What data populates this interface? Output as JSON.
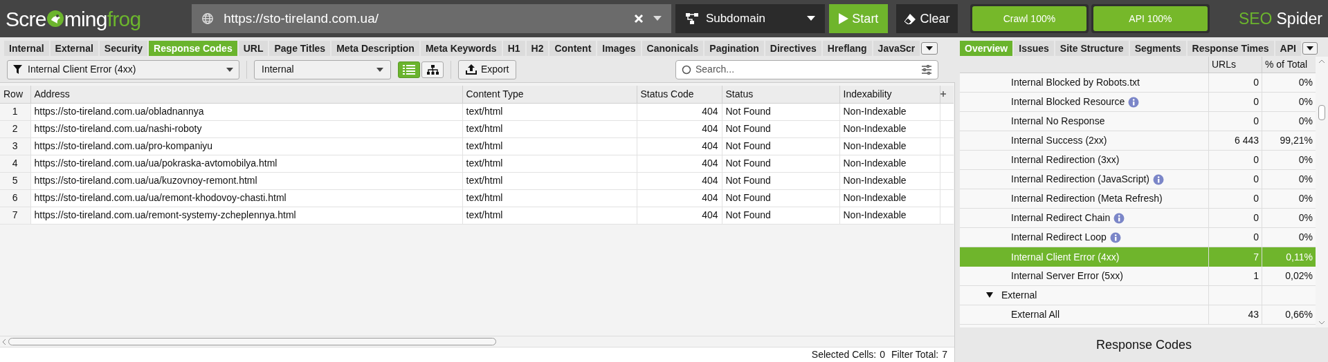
{
  "logo": {
    "parts": [
      {
        "text": "Scre",
        "color": "#ffffff"
      },
      {
        "text": "ming",
        "color": "#ffffff"
      },
      {
        "text": "frog",
        "color": "#6cb52d"
      }
    ]
  },
  "url_field": {
    "value": "https://sto-tireland.com.ua/"
  },
  "mode_dropdown": {
    "value": "Subdomain"
  },
  "start_button": "Start",
  "clear_button": "Clear",
  "progress": [
    {
      "label": "Crawl 100%",
      "level": 1
    },
    {
      "label": "API 100%",
      "level": 1
    }
  ],
  "brand": {
    "parts": [
      {
        "text": "SEO",
        "color": "#6cb52d"
      },
      {
        "text": "Spider",
        "color": "#ffffff"
      }
    ]
  },
  "left_tabs": [
    {
      "label": "Internal",
      "selected": false
    },
    {
      "label": "External",
      "selected": false
    },
    {
      "label": "Security",
      "selected": false
    },
    {
      "label": "Response Codes",
      "selected": true
    },
    {
      "label": "URL",
      "selected": false
    },
    {
      "label": "Page Titles",
      "selected": false
    },
    {
      "label": "Meta Description",
      "selected": false
    },
    {
      "label": "Meta Keywords",
      "selected": false
    },
    {
      "label": "H1",
      "selected": false
    },
    {
      "label": "H2",
      "selected": false
    },
    {
      "label": "Content",
      "selected": false
    },
    {
      "label": "Images",
      "selected": false
    },
    {
      "label": "Canonicals",
      "selected": false
    },
    {
      "label": "Pagination",
      "selected": false
    },
    {
      "label": "Directives",
      "selected": false
    },
    {
      "label": "Hreflang",
      "selected": false
    },
    {
      "label": "JavaScr",
      "selected": false
    }
  ],
  "toolbar": {
    "filter": "Internal Client Error (4xx)",
    "scope": "Internal",
    "views": [
      {
        "kind": "list",
        "selected": true
      },
      {
        "kind": "tree",
        "selected": false
      }
    ],
    "export": "Export",
    "search": {
      "placeholder": "Search..."
    }
  },
  "table": {
    "columns": [
      "Row",
      "Address",
      "Content Type",
      "Status Code",
      "Status",
      "Indexability"
    ],
    "rows": [
      [
        "1",
        "https://sto-tireland.com.ua/obladnannya",
        "text/html",
        "404",
        "Not Found",
        "Non-Indexable"
      ],
      [
        "2",
        "https://sto-tireland.com.ua/nashi-roboty",
        "text/html",
        "404",
        "Not Found",
        "Non-Indexable"
      ],
      [
        "3",
        "https://sto-tireland.com.ua/pro-kompaniyu",
        "text/html",
        "404",
        "Not Found",
        "Non-Indexable"
      ],
      [
        "4",
        "https://sto-tireland.com.ua/ua/pokraska-avtomobilya.html",
        "text/html",
        "404",
        "Not Found",
        "Non-Indexable"
      ],
      [
        "5",
        "https://sto-tireland.com.ua/ua/kuzovnoy-remont.html",
        "text/html",
        "404",
        "Not Found",
        "Non-Indexable"
      ],
      [
        "6",
        "https://sto-tireland.com.ua/ua/remont-khodovoy-chasti.html",
        "text/html",
        "404",
        "Not Found",
        "Non-Indexable"
      ],
      [
        "7",
        "https://sto-tireland.com.ua/remont-systemy-zcheplennya.html",
        "text/html",
        "404",
        "Not Found",
        "Non-Indexable"
      ]
    ]
  },
  "status_bar": {
    "selected_label": "Selected Cells:",
    "selected_value": "0",
    "filter_label": "Filter Total:",
    "filter_value": "7"
  },
  "right_tabs": [
    {
      "label": "Overview",
      "selected": true
    },
    {
      "label": "Issues",
      "selected": false
    },
    {
      "label": "Site Structure",
      "selected": false
    },
    {
      "label": "Segments",
      "selected": false
    },
    {
      "label": "Response Times",
      "selected": false
    },
    {
      "label": "API",
      "selected": false
    }
  ],
  "overview": {
    "columns": [
      "URLs",
      "% of Total"
    ],
    "rows": [
      {
        "kind": "item",
        "label": "Internal Blocked by Robots.txt",
        "urls": "0",
        "percent": "0%",
        "info": false,
        "selected": false
      },
      {
        "kind": "item",
        "label": "Internal Blocked Resource",
        "urls": "0",
        "percent": "0%",
        "info": true,
        "selected": false
      },
      {
        "kind": "item",
        "label": "Internal No Response",
        "urls": "0",
        "percent": "0%",
        "info": false,
        "selected": false
      },
      {
        "kind": "item",
        "label": "Internal Success (2xx)",
        "urls": "6 443",
        "percent": "99,21%",
        "info": false,
        "selected": false
      },
      {
        "kind": "item",
        "label": "Internal Redirection (3xx)",
        "urls": "0",
        "percent": "0%",
        "info": false,
        "selected": false
      },
      {
        "kind": "item",
        "label": "Internal Redirection (JavaScript)",
        "urls": "0",
        "percent": "0%",
        "info": true,
        "selected": false
      },
      {
        "kind": "item",
        "label": "Internal Redirection (Meta Refresh)",
        "urls": "0",
        "percent": "0%",
        "info": false,
        "selected": false
      },
      {
        "kind": "item",
        "label": "Internal Redirect Chain",
        "urls": "0",
        "percent": "0%",
        "info": true,
        "selected": false
      },
      {
        "kind": "item",
        "label": "Internal Redirect Loop",
        "urls": "0",
        "percent": "0%",
        "info": true,
        "selected": false
      },
      {
        "kind": "item",
        "label": "Internal Client Error (4xx)",
        "urls": "7",
        "percent": "0,11%",
        "info": false,
        "selected": true
      },
      {
        "kind": "item",
        "label": "Internal Server Error (5xx)",
        "urls": "1",
        "percent": "0,02%",
        "info": false,
        "selected": false
      },
      {
        "kind": "group",
        "label": "External",
        "expanded": true,
        "selected": false
      },
      {
        "kind": "item",
        "label": "External All",
        "urls": "43",
        "percent": "0,66%",
        "info": false,
        "selected": false
      }
    ]
  },
  "footer_title": "Response Codes"
}
